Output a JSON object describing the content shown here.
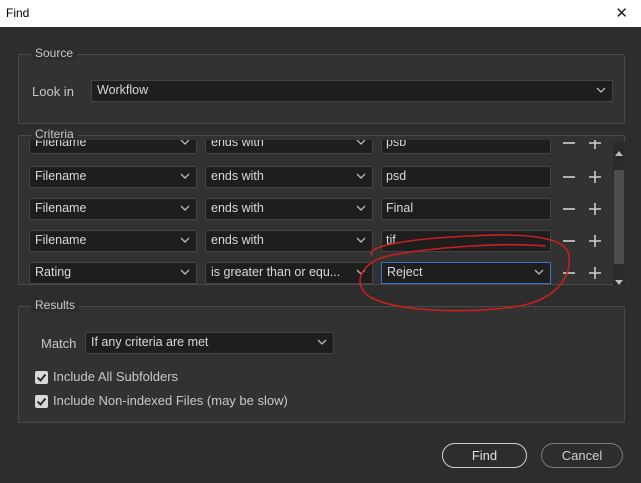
{
  "window": {
    "title": "Find",
    "close_glyph": "✕"
  },
  "source": {
    "legend": "Source",
    "look_in_label": "Look in",
    "look_in_value": "Workflow"
  },
  "criteria": {
    "legend": "Criteria",
    "rows": [
      {
        "field": "Filename",
        "operator": "ends with",
        "value": "psb"
      },
      {
        "field": "Filename",
        "operator": "ends with",
        "value": "psd"
      },
      {
        "field": "Filename",
        "operator": "ends with",
        "value": "Final"
      },
      {
        "field": "Filename",
        "operator": "ends with",
        "value": "tif"
      },
      {
        "field": "Rating",
        "operator": "is greater than or equ...",
        "value": "Reject"
      }
    ],
    "minus_glyph": "−",
    "plus_glyph": "+"
  },
  "results": {
    "legend": "Results",
    "match_label": "Match",
    "match_value": "If any criteria are met",
    "include_subfolders": {
      "label": "Include All Subfolders",
      "checked": true
    },
    "include_nonindexed": {
      "label": "Include Non-indexed Files (may be slow)",
      "checked": true
    }
  },
  "buttons": {
    "find": "Find",
    "cancel": "Cancel"
  },
  "annotation": {
    "color": "#c8201e",
    "description": "red hand-drawn circle"
  }
}
